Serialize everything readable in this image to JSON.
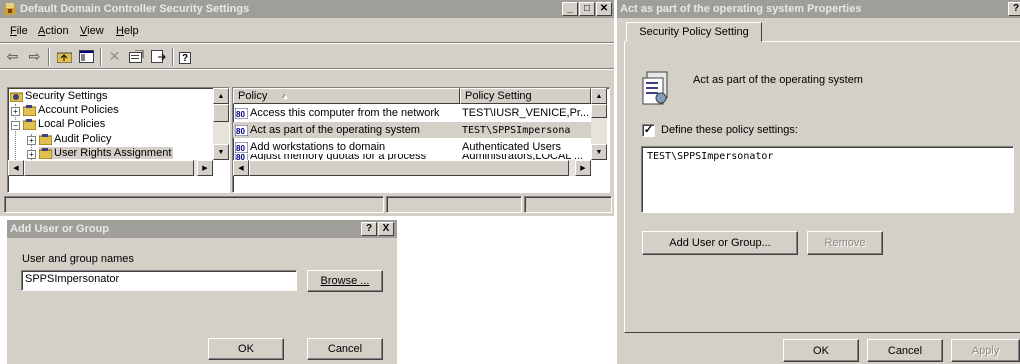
{
  "mmc": {
    "title": "Default Domain Controller Security Settings",
    "menu": [
      "File",
      "Action",
      "View",
      "Help"
    ],
    "menu_underline": [
      "F",
      "A",
      "V",
      "H"
    ],
    "tree": {
      "root": "Security Settings",
      "items": [
        "Account Policies",
        "Local Policies",
        "Audit Policy",
        "User Rights Assignment"
      ]
    },
    "columns": {
      "policy": "Policy",
      "setting": "Policy Setting",
      "sort_indicator": "▲"
    },
    "rows": [
      {
        "policy": "Access this computer from the network",
        "setting": "TEST\\IUSR_VENICE,Pr..."
      },
      {
        "policy": "Act as part of the operating system",
        "setting": "TEST\\SPPSImpersona"
      },
      {
        "policy": "Add workstations to domain",
        "setting": "Authenticated Users"
      },
      {
        "policy": "Adjust memory quotas for a process",
        "setting": "Administrators,LOCAL ..."
      }
    ],
    "selected_row": 1,
    "icons": [
      "back-arrow-icon",
      "forward-arrow-icon",
      "up-folder-icon",
      "show-hide-tree-icon",
      "delete-icon",
      "properties-icon",
      "export-icon",
      "help-icon"
    ]
  },
  "add_dialog": {
    "title": "Add User or Group",
    "label": "User and group names",
    "value": "SPPSImpersonator",
    "browse": "Browse ...",
    "ok": "OK",
    "cancel": "Cancel",
    "title_buttons": [
      "?",
      "X"
    ]
  },
  "props": {
    "title": "Act as part of the operating system Properties",
    "tab": "Security Policy Setting",
    "heading": "Act as part of the operating system",
    "checkbox_label": "Define these policy settings:",
    "checked": true,
    "list": [
      "TEST\\SPPSImpersonator"
    ],
    "add": "Add User or Group...",
    "remove": "Remove",
    "ok": "OK",
    "cancel": "Cancel",
    "apply": "Apply",
    "title_button": "?"
  },
  "colors": {
    "inactive_title": "#a09e98",
    "face": "#d4d0c8",
    "selection": "#d4d0c8"
  }
}
